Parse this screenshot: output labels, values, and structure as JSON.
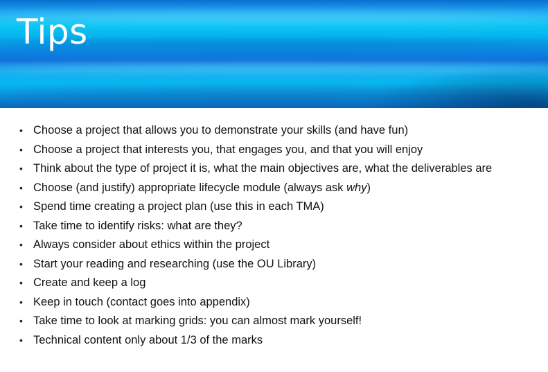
{
  "slide": {
    "title": "Tips",
    "bullets": [
      {
        "text": "Choose a project that allows you to demonstrate your skills (and have fun)"
      },
      {
        "text": "Choose a project that interests you, that engages you, and that you will enjoy"
      },
      {
        "text": "Think about the type of project it is, what the main objectives are, what the deliverables are"
      },
      {
        "text": "Choose (and justify) appropriate lifecycle module (always ask ",
        "em": "why",
        "after": ")"
      },
      {
        "text": "Spend time creating a project plan (use this in each TMA)"
      },
      {
        "text": "Take time to identify risks: what are they?"
      },
      {
        "text": "Always consider about ethics within the project"
      },
      {
        "text": "Start your reading and researching (use the OU Library)"
      },
      {
        "text": "Create and keep a log"
      },
      {
        "text": "Keep in touch (contact goes into appendix)"
      },
      {
        "text": "Take time to look at marking grids: you can almost mark yourself!"
      },
      {
        "text": "Technical content only about 1/3 of the marks"
      }
    ],
    "bullet_glyph": "•",
    "colors": {
      "banner_primary": "#0ec6f4",
      "banner_dark": "#0a64b6",
      "title_text": "#ffffff",
      "body_text": "#111111"
    }
  }
}
